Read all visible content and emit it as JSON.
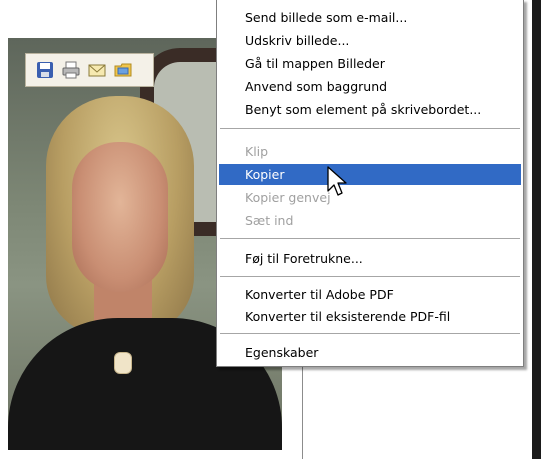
{
  "toolbar": {
    "buttons": [
      {
        "icon": "save-icon",
        "glyph": "💾"
      },
      {
        "icon": "print-icon",
        "glyph": "🖨"
      },
      {
        "icon": "email-icon",
        "glyph": "✉"
      },
      {
        "icon": "folder-icon",
        "glyph": "📂"
      }
    ]
  },
  "menu": {
    "items": [
      {
        "label": "Send billede som e-mail...",
        "enabled": true
      },
      {
        "label": "Udskriv billede...",
        "enabled": true
      },
      {
        "label": "Gå til mappen Billeder",
        "enabled": true
      },
      {
        "label": "Anvend som baggrund",
        "enabled": true
      },
      {
        "label": "Benyt som element på skrivebordet...",
        "enabled": true
      },
      {
        "label": "Klip",
        "enabled": false
      },
      {
        "label": "Kopier",
        "enabled": true,
        "selected": true
      },
      {
        "label": "Kopier genvej",
        "enabled": false
      },
      {
        "label": "Sæt ind",
        "enabled": false
      },
      {
        "label": "Føj til Foretrukne...",
        "enabled": true
      },
      {
        "label": "Konverter til Adobe PDF",
        "enabled": true
      },
      {
        "label": "Konverter til eksisterende PDF-fil",
        "enabled": true
      },
      {
        "label": "Egenskaber",
        "enabled": true
      }
    ]
  },
  "colors": {
    "selection": "#316ac5",
    "disabled_text": "#a0a0a0"
  }
}
